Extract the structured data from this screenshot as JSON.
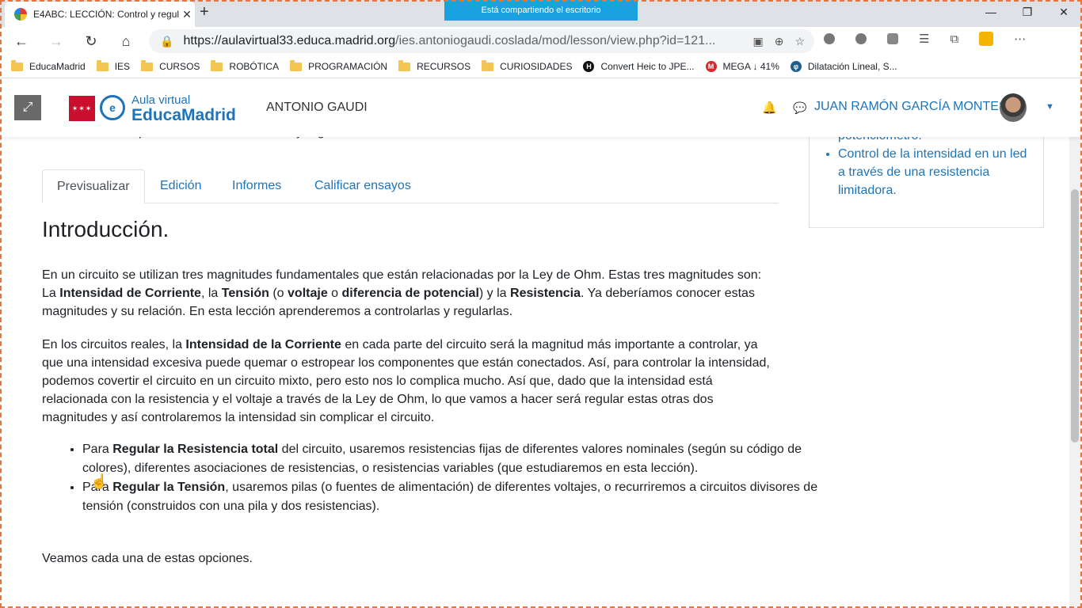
{
  "browser": {
    "tab_title": "E4ABC: LECCIÓN: Control y regul",
    "close_glyph": "✕",
    "new_tab_glyph": "+",
    "sharing_banner": "Está compartiendo el escritorio",
    "url_host": "https://aulavirtual33.educa.madrid.org",
    "url_path": "/ies.antoniogaudi.coslada/mod/lesson/view.php?id=121...",
    "window_buttons": [
      "—",
      "❐",
      "✕"
    ]
  },
  "bookmarks": [
    {
      "label": "EducaMadrid",
      "icon": "folder"
    },
    {
      "label": "IES",
      "icon": "folder"
    },
    {
      "label": "CURSOS",
      "icon": "folder"
    },
    {
      "label": "ROBÓTICA",
      "icon": "folder"
    },
    {
      "label": "PROGRAMACIÓN",
      "icon": "folder"
    },
    {
      "label": "RECURSOS",
      "icon": "folder"
    },
    {
      "label": "CURIOSIDADES",
      "icon": "folder"
    },
    {
      "label": "Convert Heic to JPE...",
      "icon": "h-icon"
    },
    {
      "label": "MEGA ↓ 41%",
      "icon": "mega-icon"
    },
    {
      "label": "Dilatación Lineal, S...",
      "icon": "d-icon"
    }
  ],
  "site": {
    "logo_small": "Aula virtual",
    "logo_big": "EducaMadrid",
    "name": "ANTONIO GAUDI",
    "user": "JUAN RAMÓN GARCÍA MONTES"
  },
  "content": {
    "cut_line": "En esta lección aprenderemos a controlarlas y regularlas.",
    "tabs": [
      "Previsualizar",
      "Edición",
      "Informes",
      "Calificar ensayos"
    ],
    "heading": "Introducción.",
    "p1": {
      "a": "En un circuito se utilizan tres magnitudes fundamentales que están relacionadas por la Ley de Ohm. Estas tres magnitudes son: La ",
      "b1": "Intensidad de Corriente",
      "c": ", la ",
      "b2": "Tensión",
      "d": " (o ",
      "b3": "voltaje",
      "e": " o ",
      "b4": "diferencia de potencial",
      "f": ") y la ",
      "b5": "Resistencia",
      "g": ". Ya deberíamos conocer estas magnitudes y su relación. En esta lección aprenderemos a controlarlas y regularlas."
    },
    "p2": {
      "a": "En los circuitos reales, la ",
      "b1": "Intensidad de la Corriente",
      "c": " en cada parte del circuito será la magnitud más importante a controlar, ya que una intensidad excesiva puede quemar o estropear los componentes que están conectados. Así, para controlar la intensidad, podemos covertir el circuito en un circuito mixto, pero esto nos lo complica mucho. Así que, dado que la intensidad está relacionada con la resistencia y el voltaje a través de la Ley de Ohm, lo que vamos a hacer será regular estas otras dos magnitudes y así controlaremos la intensidad sin complicar el circuito."
    },
    "bullets": [
      {
        "a": "Para ",
        "b": "Regular la Resistencia total",
        "c": " del circuito, usaremos resistencias fijas de diferentes valores nominales (según su código de colores), diferentes asociaciones de resistencias, o resistencias variables (que estudiaremos en esta lección)."
      },
      {
        "a": "Para ",
        "b": "Regular la Tensión",
        "c": ", usaremos pilas (o fuentes de alimentación) de diferentes voltajes, o recurriremos a circuitos divisores de tensión (construidos con una pila y dos resistencias)."
      }
    ],
    "closing": "Veamos cada una de estas opciones."
  },
  "sidebar": {
    "items": [
      "potenciómetro.",
      "Control de la intensidad en un led a través de una resistencia limitadora."
    ]
  },
  "colors": {
    "link": "#1d74bb",
    "share_banner": "#1aa2e0",
    "frame": "#e8743b"
  }
}
